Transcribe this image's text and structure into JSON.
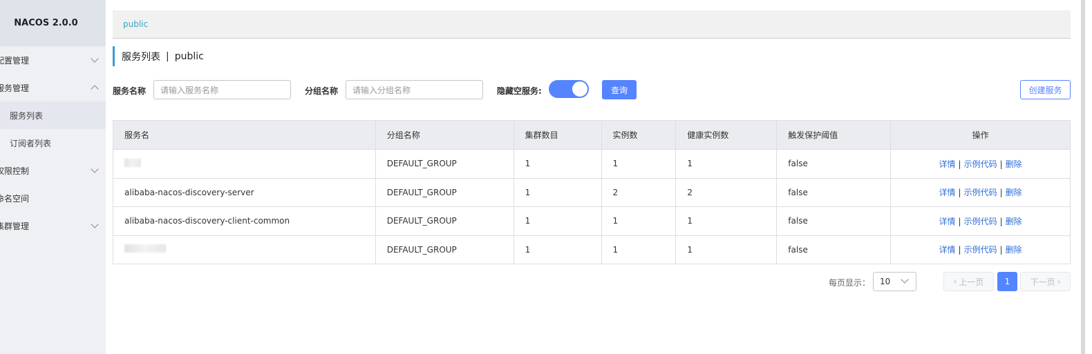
{
  "app": {
    "title": "NACOS 2.0.0"
  },
  "sidebar": {
    "items": [
      {
        "label": "配置管理",
        "expanded": false
      },
      {
        "label": "服务管理",
        "expanded": true,
        "children": [
          "服务列表",
          "订阅者列表"
        ]
      },
      {
        "label": "权限控制",
        "expanded": false
      },
      {
        "label": "命名空间"
      },
      {
        "label": "集群管理",
        "expanded": false
      }
    ]
  },
  "topbar": {
    "namespace": "public"
  },
  "page": {
    "title": "服务列表",
    "separator": "|",
    "namespace": "public"
  },
  "filters": {
    "service_name_label": "服务名称",
    "service_name_placeholder": "请输入服务名称",
    "group_name_label": "分组名称",
    "group_name_placeholder": "请输入分组名称",
    "hide_empty_label": "隐藏空服务:",
    "hide_empty_on": true,
    "query_label": "查询",
    "create_label": "创建服务"
  },
  "table": {
    "headers": [
      "服务名",
      "分组名称",
      "集群数目",
      "实例数",
      "健康实例数",
      "触发保护阈值",
      "操作"
    ],
    "rows": [
      {
        "name": "",
        "group": "DEFAULT_GROUP",
        "clusters": "1",
        "instances": "1",
        "healthy": "1",
        "threshold": "false"
      },
      {
        "name": "alibaba-nacos-discovery-server",
        "group": "DEFAULT_GROUP",
        "clusters": "1",
        "instances": "2",
        "healthy": "2",
        "threshold": "false"
      },
      {
        "name": "alibaba-nacos-discovery-client-common",
        "group": "DEFAULT_GROUP",
        "clusters": "1",
        "instances": "1",
        "healthy": "1",
        "threshold": "false"
      },
      {
        "name": "",
        "group": "DEFAULT_GROUP",
        "clusters": "1",
        "instances": "1",
        "healthy": "1",
        "threshold": "false"
      }
    ],
    "actions": {
      "detail": "详情",
      "sample": "示例代码",
      "delete": "删除",
      "sep": "|"
    }
  },
  "pagination": {
    "page_size_label": "每页显示：",
    "page_size": "10",
    "prev": "上一页",
    "current": "1",
    "next": "下一页"
  },
  "colors": {
    "primary": "#5584ff",
    "link": "#2f6ed6",
    "accent": "#35a7c3"
  }
}
